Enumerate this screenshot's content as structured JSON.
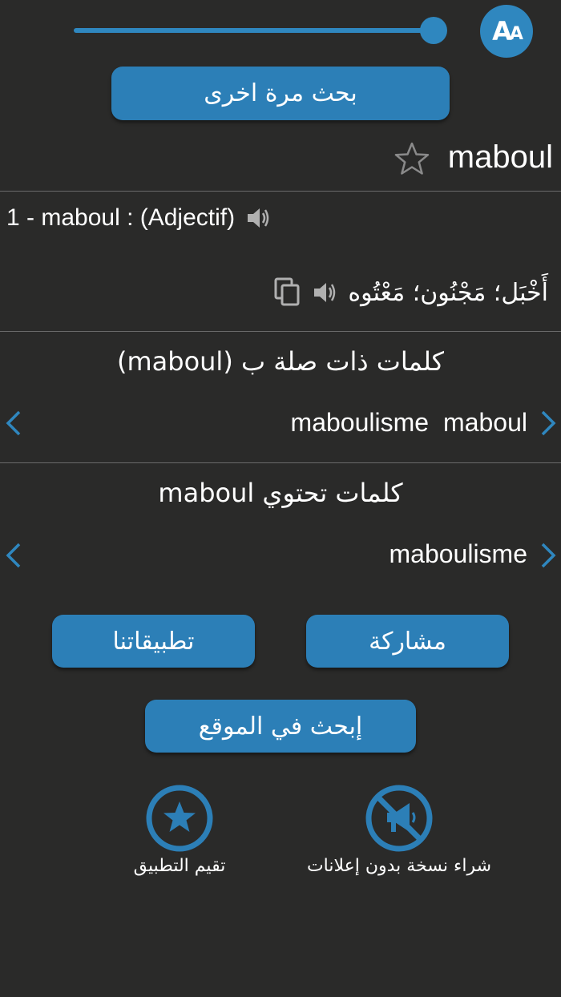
{
  "font_control": {
    "icon_letters_big": "A",
    "icon_letters_small": "A",
    "size_level": 1.0
  },
  "search_again_label": "بحث مرة اخرى",
  "word": "maboul",
  "definition": {
    "header": "1 - maboul : (Adjectif)",
    "arabic": "أَخْبَل؛ مَجْنُون؛ مَعْتُوه"
  },
  "related": {
    "title": "كلمات ذات صلة ب (maboul)",
    "words": [
      "maboulisme",
      "maboul"
    ]
  },
  "containing": {
    "title": "كلمات تحتوي maboul",
    "words": [
      "maboulisme"
    ]
  },
  "buttons": {
    "share": "مشاركة",
    "apps": "تطبيقاتنا",
    "search_site": "إبحث في الموقع"
  },
  "bottom_actions": {
    "no_ads": "شراء نسخة بدون إعلانات",
    "rate": "تقيم التطبيق"
  },
  "colors": {
    "background": "#2a2a29",
    "accent": "#2c7fb7",
    "divider": "#6a6a6a"
  }
}
